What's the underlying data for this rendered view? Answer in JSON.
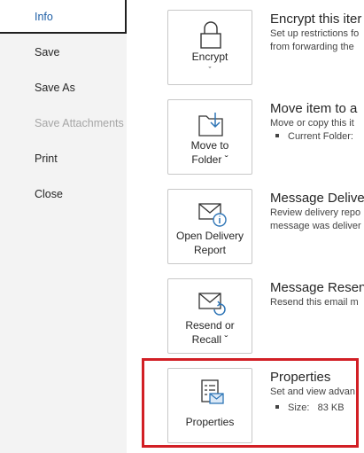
{
  "sidebar": {
    "items": [
      {
        "label": "Info",
        "state": "active"
      },
      {
        "label": "Save",
        "state": "normal"
      },
      {
        "label": "Save As",
        "state": "normal"
      },
      {
        "label": "Save Attachments",
        "state": "disabled"
      },
      {
        "label": "Print",
        "state": "normal"
      },
      {
        "label": "Close",
        "state": "normal"
      }
    ]
  },
  "actions": [
    {
      "button_line1": "Encrypt",
      "button_chevron": "ˇ",
      "title": "Encrypt this iter",
      "text_lines": [
        "Set up restrictions fo",
        "from forwarding the"
      ],
      "icon": "lock-icon"
    },
    {
      "button_line1": "Move to",
      "button_line2": "Folder ˇ",
      "title": "Move item to a",
      "text_lines": [
        "Move or copy this it"
      ],
      "bullet": "Current Folder:",
      "icon": "move-to-folder-icon"
    },
    {
      "button_line1": "Open Delivery",
      "button_line2": "Report",
      "title": "Message Delive",
      "text_lines": [
        "Review delivery repo",
        "message was deliver"
      ],
      "icon": "delivery-report-icon"
    },
    {
      "button_line1": "Resend or",
      "button_line2": "Recall ˇ",
      "title": "Message Resenc",
      "text_lines": [
        "Resend this email m"
      ],
      "icon": "resend-recall-icon"
    },
    {
      "button_line1": "Properties",
      "title": "Properties",
      "text_lines": [
        "Set and view advan"
      ],
      "bullet_label": "Size:",
      "bullet_value": "83 KB",
      "icon": "properties-icon"
    }
  ],
  "colors": {
    "highlight": "#d21f25",
    "accent": "#1f5fa6",
    "sidebar_bg": "#f3f3f3"
  }
}
